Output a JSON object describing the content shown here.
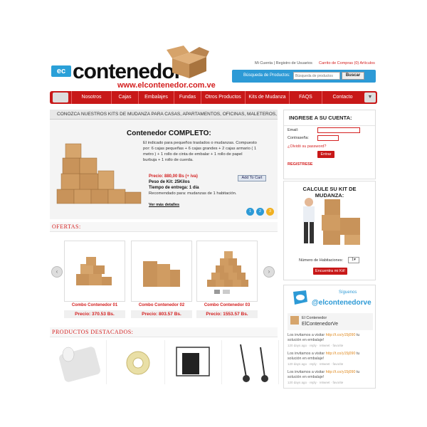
{
  "header": {
    "logo_badge": "ec",
    "logo_name": "contenedor",
    "logo_url": "www.elcontenedor.com.ve",
    "top_links": "Mi Cuenta | Registro de Usuarios",
    "cart_link": "Carrito de Compras (0) Artículos",
    "search_label": "Búsqueda de Productos:",
    "search_placeholder": "Búsqueda de productos",
    "search_button": "Buscar"
  },
  "nav": {
    "items": [
      "Nosotros",
      "Cajas",
      "Embalajes",
      "Fundas",
      "Otros Productos",
      "Kits de Mudanza",
      "FAQS",
      "Contacto"
    ]
  },
  "main": {
    "kits_banner": "CONOZCA NUESTROS KITS DE MUDANZA PARA CASAS, APARTAMENTOS, OFICINAS, MALETEROS, CLOSETS",
    "feature": {
      "title": "Contenedor COMPLETO:",
      "description": "El indicado para pequeños traslados o mudanzas. Compuesto por: 6 cajas pequeñas + 6 cajas grandes + 2 cajas armario ( 1 metro ) + 1 rollo de cinta de embalar + 1 rollo de papel burbuja + 1 rollo de cuerda.",
      "price": "Precio: 880,00 Bs (+ iva)",
      "weight": "Peso de Kit: 25Kilos",
      "time": "Tiempo de entrega: 1 día",
      "recommended": "Recomendado para: mudanzas de 1 habitación.",
      "add_to_cart": "Add To Cart",
      "more_details": "Ver más detalles",
      "pager": [
        "1",
        "2",
        "3"
      ]
    },
    "offers_title": "OFERTAS:",
    "offers": [
      {
        "name": "Combo Contenedor 01",
        "price": "Precio: 370.53 Bs."
      },
      {
        "name": "Combo Contenedor 02",
        "price": "Precio: 803.57 Bs."
      },
      {
        "name": "Combo Contenedor 03",
        "price": "Precio: 1553.57 Bs."
      }
    ],
    "featured_title": "PRODUCTOS DESTACADOS:"
  },
  "sidebar": {
    "login": {
      "title": "INGRESE A SU CUENTA:",
      "email_label": "Email:",
      "password_label": "Contraseña:",
      "forgot": "¿Olvidó su password?",
      "submit": "Entrar",
      "register": "REGISTRESE"
    },
    "calc": {
      "title": "CALCULE SU KIT DE MUDANZA:",
      "rooms_label": "Número de Habitaciones:",
      "rooms_value": "1",
      "button": "Encuentra mi Kit!"
    },
    "twitter": {
      "follow_label": "Síguenos",
      "handle": "@elcontenedorve",
      "account_name": "El Contenedor",
      "account_handle": "ElContenedorVe",
      "tweets": [
        {
          "text": "Los invitamos a visitar ",
          "link": "http://t.co/y15j090",
          "text2": " tu solución en embalaje!",
          "meta": "120 days ago · reply · retweet · favorite"
        },
        {
          "text": "Los invitamos a visitar ",
          "link": "http://t.co/y15j090",
          "text2": " tu solución en embalaje!",
          "meta": "120 days ago · reply · retweet · favorite"
        },
        {
          "text": "Los invitamos a visitar ",
          "link": "http://t.co/y15j090",
          "text2": " tu solución en embalaje!",
          "meta": "120 days ago · reply · retweet · favorite"
        }
      ]
    }
  },
  "colors": {
    "brand_red": "#c81818",
    "brand_blue": "#2d9ad6",
    "box_brown": "#c8935a"
  }
}
